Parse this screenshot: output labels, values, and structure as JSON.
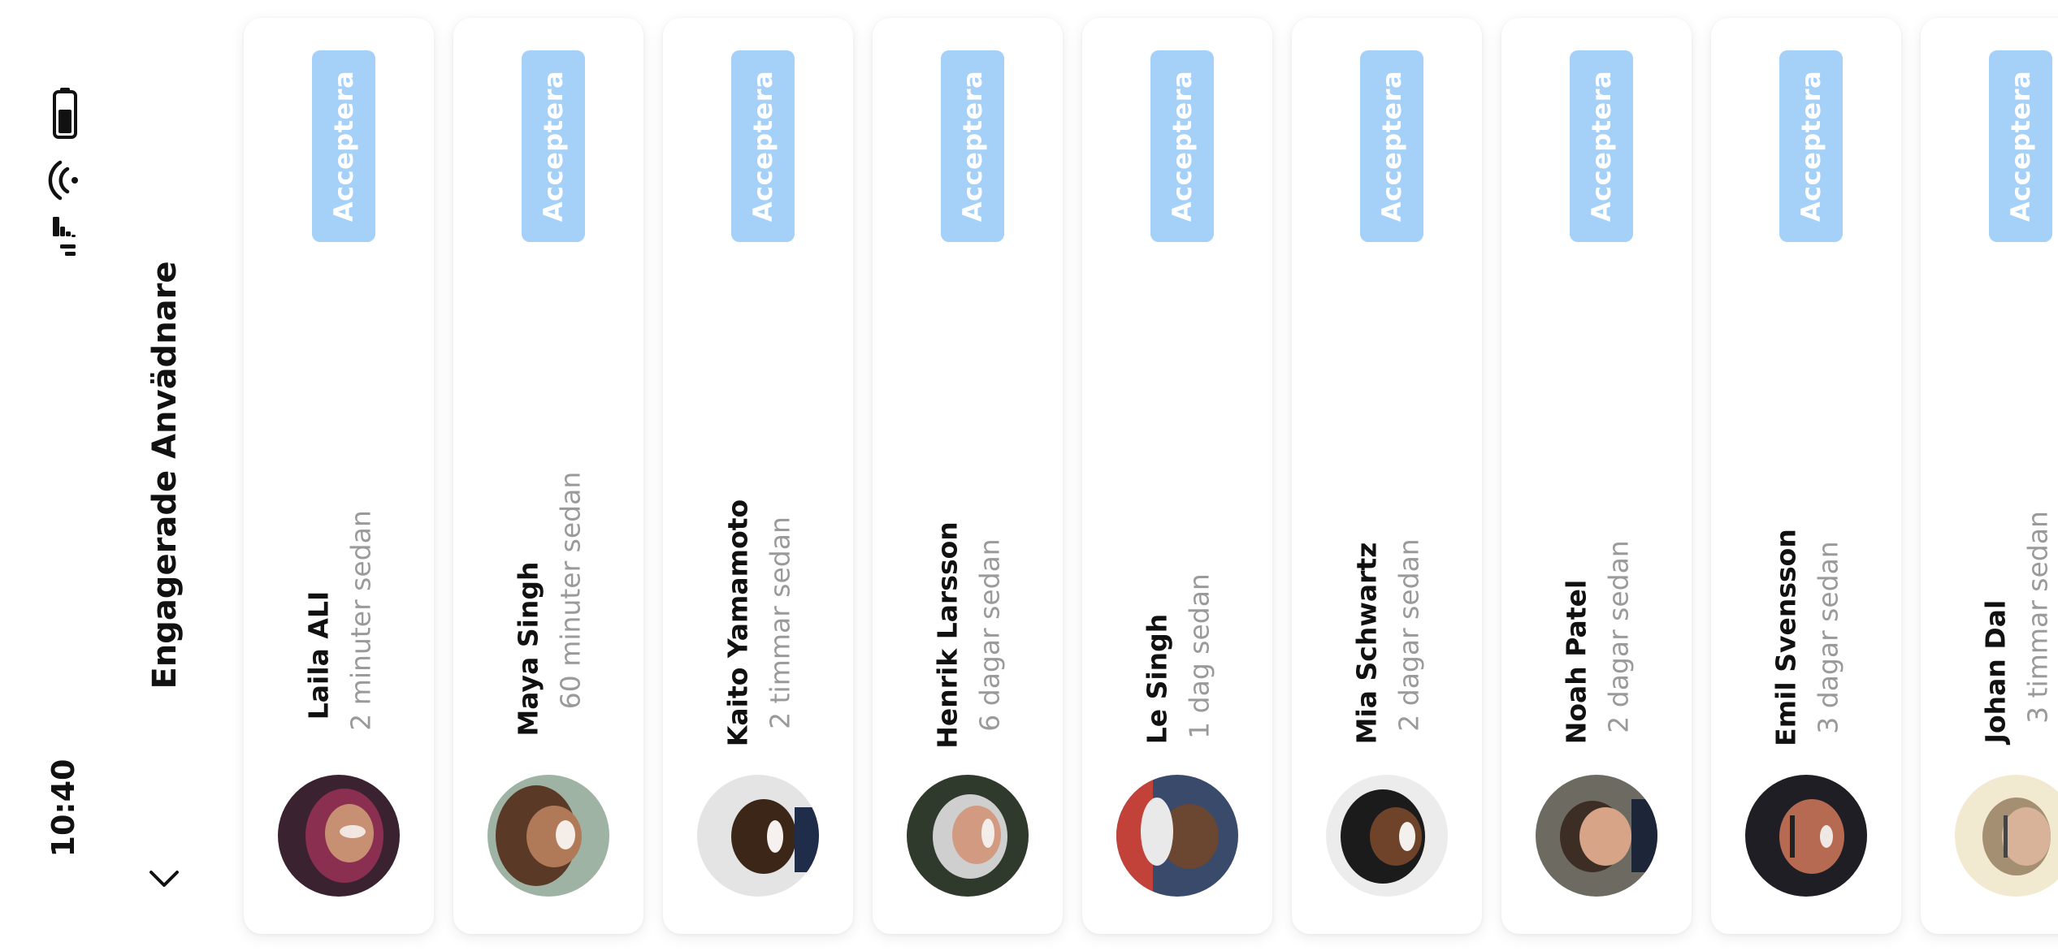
{
  "status_bar": {
    "time": "10:40",
    "signal_icon": "signal-bars-icon",
    "wifi_icon": "wifi-icon",
    "battery_icon": "battery-icon"
  },
  "header": {
    "title": "Engagerade Anvädnare",
    "back_icon": "chevron-down-icon"
  },
  "colors": {
    "accept_button": "#a5d0f7",
    "secondary_text": "#9a9a9a"
  },
  "users": [
    {
      "name": "Laila ALI",
      "time": "2 minuter sedan",
      "action": "Acceptera",
      "avatar_icon": "avatar-photo-icon"
    },
    {
      "name": "Maya Singh",
      "time": "60 minuter sedan",
      "action": "Acceptera",
      "avatar_icon": "avatar-photo-icon"
    },
    {
      "name": "Kaito Yamamoto",
      "time": "2 timmar sedan",
      "action": "Acceptera",
      "avatar_icon": "avatar-photo-icon"
    },
    {
      "name": "Henrik Larsson",
      "time": "6 dagar sedan",
      "action": "Acceptera",
      "avatar_icon": "avatar-photo-icon"
    },
    {
      "name": "Le Singh",
      "time": "1 dag sedan",
      "action": "Acceptera",
      "avatar_icon": "avatar-photo-icon"
    },
    {
      "name": "Mia Schwartz",
      "time": "2 dagar sedan",
      "action": "Acceptera",
      "avatar_icon": "avatar-photo-icon"
    },
    {
      "name": "Noah Patel",
      "time": "2 dagar sedan",
      "action": "Acceptera",
      "avatar_icon": "avatar-photo-icon"
    },
    {
      "name": "Emil Svensson",
      "time": "3 dagar sedan",
      "action": "Acceptera",
      "avatar_icon": "avatar-photo-icon"
    },
    {
      "name": "Johan Dal",
      "time": "3 timmar sedan",
      "action": "Acceptera",
      "avatar_icon": "avatar-photo-icon"
    }
  ]
}
